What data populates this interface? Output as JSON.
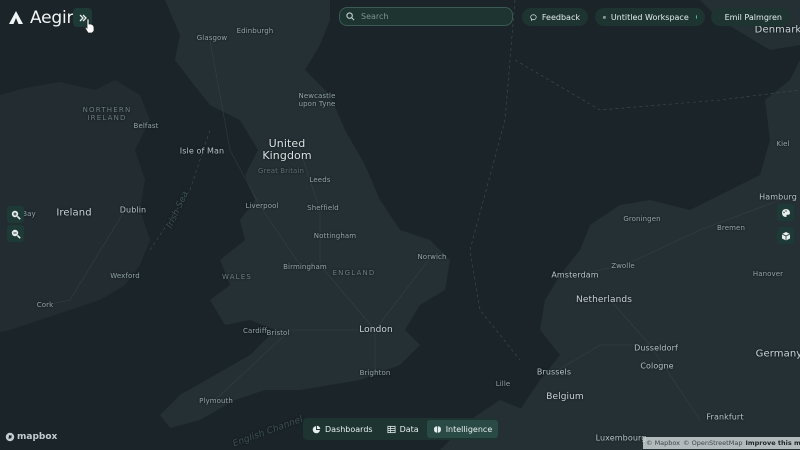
{
  "app": {
    "name": "Aegir"
  },
  "header": {
    "search_placeholder": "Search",
    "feedback_label": "Feedback",
    "workspace_label": "Untitled Workspace",
    "user_label": "Emil Palmgren"
  },
  "icons": {
    "logo": "aegir-logo-icon",
    "expand": "chevrons-right-icon",
    "search": "search-icon",
    "feedback": "chat-bubble-icon",
    "workspace": "grid-icon",
    "user": "user-icon",
    "zoom_in": "zoom-in-icon",
    "zoom_out": "zoom-out-icon",
    "layers": "palette-icon",
    "cube": "cube-icon"
  },
  "bottom_nav": {
    "tabs": [
      {
        "label": "Dashboards",
        "icon": "pie-chart-icon"
      },
      {
        "label": "Data",
        "icon": "table-icon"
      },
      {
        "label": "Intelligence",
        "icon": "brain-icon"
      }
    ]
  },
  "map": {
    "labels": {
      "denmark": "Denmark",
      "germany": "Germany",
      "netherlands": "Netherlands",
      "belgium": "Belgium",
      "united_kingdom": "United\nKingdom",
      "great_britain": "Great Britain",
      "ireland": "Ireland",
      "northern_ireland": "NORTHERN\nIRELAND",
      "england": "ENGLAND",
      "wales": "WALES",
      "isle_of_man": "Isle of Man",
      "glasgow": "Glasgow",
      "edinburgh": "Edinburgh",
      "newcastle": "Newcastle\nupon Tyne",
      "belfast": "Belfast",
      "leeds": "Leeds",
      "liverpool": "Liverpool",
      "sheffield": "Sheffield",
      "nottingham": "Nottingham",
      "birmingham": "Birmingham",
      "norwich": "Norwich",
      "london": "London",
      "cardiff": "Cardiff",
      "bristol": "Bristol",
      "brighton": "Brighton",
      "plymouth": "Plymouth",
      "dublin": "Dublin",
      "wexford": "Wexford",
      "cork": "Cork",
      "bay": "Bay",
      "kiel": "Kiel",
      "hamburg": "Hamburg",
      "bremen": "Bremen",
      "groningen": "Groningen",
      "zwolle": "Zwolle",
      "amsterdam": "Amsterdam",
      "hanover": "Hanover",
      "dusseldorf": "Dusseldorf",
      "cologne": "Cologne",
      "brussels": "Brussels",
      "lille": "Lille",
      "frankfurt": "Frankfurt",
      "luxembourg": "Luxembourg",
      "irish_sea": "Irish Sea",
      "english_channel": "English Channel"
    }
  },
  "footer": {
    "mapbox": "mapbox",
    "attribution_mapbox": "© Mapbox",
    "attribution_osm": "© OpenStreetMap",
    "attribution_improve": "Improve this map"
  },
  "colors": {
    "water": "#1b2428",
    "land": "#243034",
    "accent_panel": "#1d3431",
    "status_online": "#49c48a"
  }
}
